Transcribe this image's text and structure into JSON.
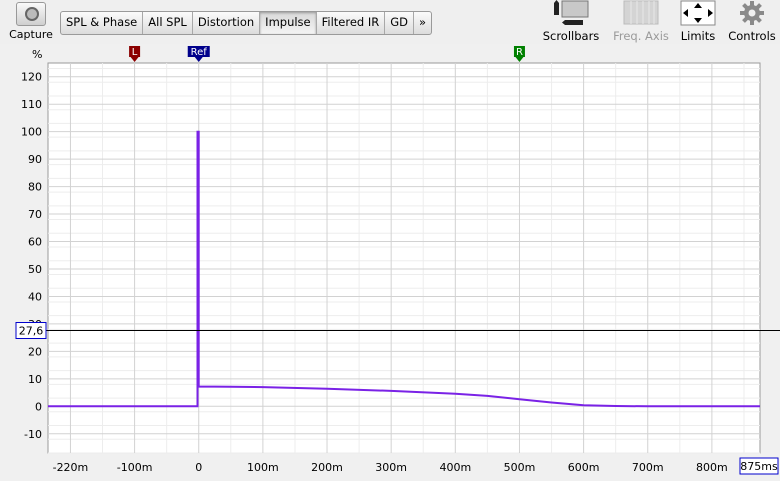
{
  "toolbar": {
    "capture_label": "Capture",
    "tabs": [
      "SPL & Phase",
      "All SPL",
      "Distortion",
      "Impulse",
      "Filtered IR",
      "GD",
      "»"
    ],
    "active_tab": "Impulse",
    "scrollbars_label": "Scrollbars",
    "freq_axis_label": "Freq. Axis",
    "limits_label": "Limits",
    "controls_label": "Controls"
  },
  "markers": {
    "left": "L",
    "ref": "Ref",
    "right": "R"
  },
  "cursor_readout": "27,6",
  "x_end_label": "875ms",
  "colors": {
    "trace": "#7a22e6",
    "marker_left": "#8b0000",
    "marker_ref": "#00008b",
    "marker_right": "#008000",
    "readout_border": "#0000cc"
  },
  "chart_data": {
    "type": "line",
    "ylabel": "%",
    "xlim": [
      -235,
      875
    ],
    "ylim": [
      -17,
      125
    ],
    "xticks": [
      -200,
      -100,
      0,
      100,
      200,
      300,
      400,
      500,
      600,
      700,
      800
    ],
    "xtick_labels": [
      "-220m",
      "-100m",
      "0",
      "100m",
      "200m",
      "300m",
      "400m",
      "500m",
      "600m",
      "700m",
      "800m"
    ],
    "yticks": [
      120,
      110,
      100,
      90,
      80,
      70,
      60,
      50,
      40,
      30,
      20,
      10,
      0,
      -10
    ],
    "grid": true,
    "markers_x": {
      "L": -100,
      "Ref": 0,
      "R": 500
    },
    "cursor_y": 27.6,
    "series": [
      {
        "x": [
          -235,
          -2,
          -2,
          0,
          0,
          50,
          100,
          200,
          300,
          400,
          450,
          500,
          550,
          600,
          650,
          700,
          875
        ],
        "values": [
          0,
          0,
          100,
          100,
          7.2,
          7.1,
          7,
          6.4,
          5.6,
          4.6,
          3.8,
          2.6,
          1.4,
          0.4,
          0.1,
          0,
          0
        ]
      }
    ]
  }
}
